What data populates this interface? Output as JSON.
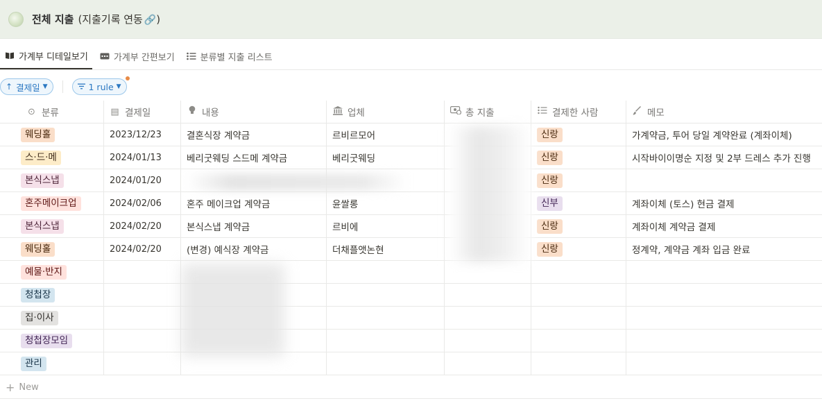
{
  "header": {
    "title": "전체 지출",
    "subtitle": "(지출기록 연동",
    "subtitle_end": ")",
    "link_icon": "link-icon"
  },
  "tabs": [
    {
      "label": "가계부 디테일보기",
      "icon": "book-icon",
      "active": true
    },
    {
      "label": "가계부 간편보기",
      "icon": "card-icon",
      "active": false
    },
    {
      "label": "분류별 지출 리스트",
      "icon": "list-icon",
      "active": false
    }
  ],
  "filters": {
    "sort_label": "결제일",
    "rule_label": "1 rule"
  },
  "columns": [
    {
      "label": "분류",
      "icon": "select-icon"
    },
    {
      "label": "결제일",
      "icon": "calendar-icon"
    },
    {
      "label": "내용",
      "icon": "bulb-icon"
    },
    {
      "label": "업체",
      "icon": "bank-icon"
    },
    {
      "label": "총 지출",
      "icon": "money-icon"
    },
    {
      "label": "결제한 사람",
      "icon": "list-icon"
    },
    {
      "label": "메모",
      "icon": "brush-icon"
    }
  ],
  "rows": [
    {
      "category": "웨딩홀",
      "category_color": "orange",
      "date": "2023/12/23",
      "content": "결혼식장 계약금",
      "vendor": "르비르모어",
      "payer": "신랑",
      "payer_color": "orange",
      "memo": "가계약금, 투어 당일 계약완료 (계좌이체)"
    },
    {
      "category": "스·드·메",
      "category_color": "yellow",
      "date": "2024/01/13",
      "content": "베리굿웨딩 스드메 계약금",
      "vendor": "베리굿웨딩",
      "payer": "신랑",
      "payer_color": "orange",
      "memo": "시작바이이명순 지정 및 2부 드레스 추가 진행"
    },
    {
      "category": "본식스냅",
      "category_color": "pink",
      "date": "2024/01/20",
      "content": "",
      "vendor": "",
      "payer": "신랑",
      "payer_color": "orange",
      "memo": ""
    },
    {
      "category": "혼주메이크업",
      "category_color": "red",
      "date": "2024/02/06",
      "content": "혼주 메이크업 계약금",
      "vendor": "윤쌀롱",
      "payer": "신부",
      "payer_color": "purple",
      "memo": "계좌이체 (토스) 현금 결제"
    },
    {
      "category": "본식스냅",
      "category_color": "pink",
      "date": "2024/02/20",
      "content": "본식스냅 계약금",
      "vendor": "르비에",
      "payer": "신랑",
      "payer_color": "orange",
      "memo": "계좌이체 계약금 결제"
    },
    {
      "category": "웨딩홀",
      "category_color": "orange",
      "date": "2024/02/20",
      "content": "(변경) 예식장 계약금",
      "vendor": "더채플앳논현",
      "payer": "신랑",
      "payer_color": "orange",
      "memo": "정계약, 계약금 계좌 입금 완료"
    },
    {
      "category": "예물·반지",
      "category_color": "red",
      "date": "",
      "content": "",
      "vendor": "",
      "payer": "",
      "payer_color": "",
      "memo": ""
    },
    {
      "category": "청첩장",
      "category_color": "blue",
      "date": "",
      "content": "",
      "vendor": "",
      "payer": "",
      "payer_color": "",
      "memo": ""
    },
    {
      "category": "집·이사",
      "category_color": "gray",
      "date": "",
      "content": "",
      "vendor": "",
      "payer": "",
      "payer_color": "",
      "memo": ""
    },
    {
      "category": "청첩장모임",
      "category_color": "purple",
      "date": "",
      "content": "",
      "vendor": "",
      "payer": "",
      "payer_color": "",
      "memo": ""
    },
    {
      "category": "관리",
      "category_color": "blue",
      "date": "",
      "content": "",
      "vendor": "",
      "payer": "",
      "payer_color": "",
      "memo": ""
    }
  ],
  "new_label": "New"
}
